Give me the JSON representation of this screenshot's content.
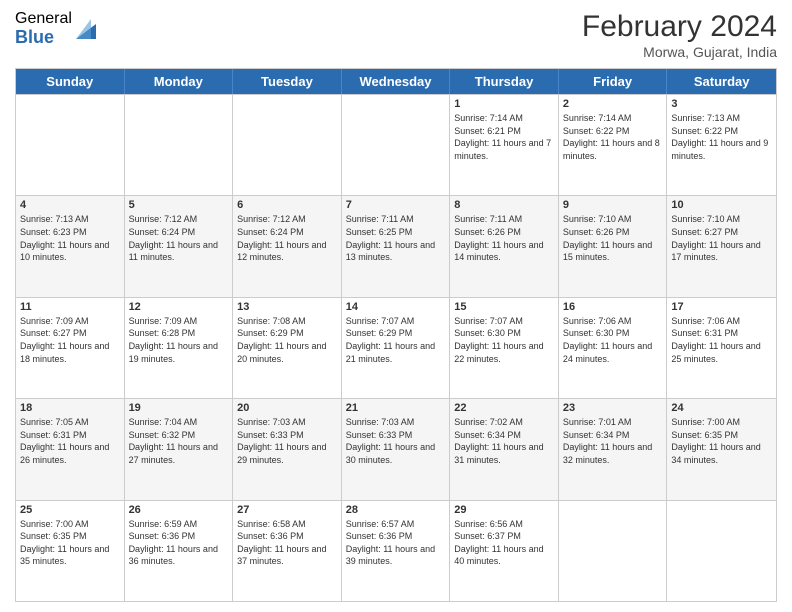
{
  "header": {
    "logo_general": "General",
    "logo_blue": "Blue",
    "month_year": "February 2024",
    "location": "Morwa, Gujarat, India"
  },
  "weekdays": [
    "Sunday",
    "Monday",
    "Tuesday",
    "Wednesday",
    "Thursday",
    "Friday",
    "Saturday"
  ],
  "rows": [
    [
      {
        "day": "",
        "info": ""
      },
      {
        "day": "",
        "info": ""
      },
      {
        "day": "",
        "info": ""
      },
      {
        "day": "",
        "info": ""
      },
      {
        "day": "1",
        "info": "Sunrise: 7:14 AM\nSunset: 6:21 PM\nDaylight: 11 hours and 7 minutes."
      },
      {
        "day": "2",
        "info": "Sunrise: 7:14 AM\nSunset: 6:22 PM\nDaylight: 11 hours and 8 minutes."
      },
      {
        "day": "3",
        "info": "Sunrise: 7:13 AM\nSunset: 6:22 PM\nDaylight: 11 hours and 9 minutes."
      }
    ],
    [
      {
        "day": "4",
        "info": "Sunrise: 7:13 AM\nSunset: 6:23 PM\nDaylight: 11 hours and 10 minutes."
      },
      {
        "day": "5",
        "info": "Sunrise: 7:12 AM\nSunset: 6:24 PM\nDaylight: 11 hours and 11 minutes."
      },
      {
        "day": "6",
        "info": "Sunrise: 7:12 AM\nSunset: 6:24 PM\nDaylight: 11 hours and 12 minutes."
      },
      {
        "day": "7",
        "info": "Sunrise: 7:11 AM\nSunset: 6:25 PM\nDaylight: 11 hours and 13 minutes."
      },
      {
        "day": "8",
        "info": "Sunrise: 7:11 AM\nSunset: 6:26 PM\nDaylight: 11 hours and 14 minutes."
      },
      {
        "day": "9",
        "info": "Sunrise: 7:10 AM\nSunset: 6:26 PM\nDaylight: 11 hours and 15 minutes."
      },
      {
        "day": "10",
        "info": "Sunrise: 7:10 AM\nSunset: 6:27 PM\nDaylight: 11 hours and 17 minutes."
      }
    ],
    [
      {
        "day": "11",
        "info": "Sunrise: 7:09 AM\nSunset: 6:27 PM\nDaylight: 11 hours and 18 minutes."
      },
      {
        "day": "12",
        "info": "Sunrise: 7:09 AM\nSunset: 6:28 PM\nDaylight: 11 hours and 19 minutes."
      },
      {
        "day": "13",
        "info": "Sunrise: 7:08 AM\nSunset: 6:29 PM\nDaylight: 11 hours and 20 minutes."
      },
      {
        "day": "14",
        "info": "Sunrise: 7:07 AM\nSunset: 6:29 PM\nDaylight: 11 hours and 21 minutes."
      },
      {
        "day": "15",
        "info": "Sunrise: 7:07 AM\nSunset: 6:30 PM\nDaylight: 11 hours and 22 minutes."
      },
      {
        "day": "16",
        "info": "Sunrise: 7:06 AM\nSunset: 6:30 PM\nDaylight: 11 hours and 24 minutes."
      },
      {
        "day": "17",
        "info": "Sunrise: 7:06 AM\nSunset: 6:31 PM\nDaylight: 11 hours and 25 minutes."
      }
    ],
    [
      {
        "day": "18",
        "info": "Sunrise: 7:05 AM\nSunset: 6:31 PM\nDaylight: 11 hours and 26 minutes."
      },
      {
        "day": "19",
        "info": "Sunrise: 7:04 AM\nSunset: 6:32 PM\nDaylight: 11 hours and 27 minutes."
      },
      {
        "day": "20",
        "info": "Sunrise: 7:03 AM\nSunset: 6:33 PM\nDaylight: 11 hours and 29 minutes."
      },
      {
        "day": "21",
        "info": "Sunrise: 7:03 AM\nSunset: 6:33 PM\nDaylight: 11 hours and 30 minutes."
      },
      {
        "day": "22",
        "info": "Sunrise: 7:02 AM\nSunset: 6:34 PM\nDaylight: 11 hours and 31 minutes."
      },
      {
        "day": "23",
        "info": "Sunrise: 7:01 AM\nSunset: 6:34 PM\nDaylight: 11 hours and 32 minutes."
      },
      {
        "day": "24",
        "info": "Sunrise: 7:00 AM\nSunset: 6:35 PM\nDaylight: 11 hours and 34 minutes."
      }
    ],
    [
      {
        "day": "25",
        "info": "Sunrise: 7:00 AM\nSunset: 6:35 PM\nDaylight: 11 hours and 35 minutes."
      },
      {
        "day": "26",
        "info": "Sunrise: 6:59 AM\nSunset: 6:36 PM\nDaylight: 11 hours and 36 minutes."
      },
      {
        "day": "27",
        "info": "Sunrise: 6:58 AM\nSunset: 6:36 PM\nDaylight: 11 hours and 37 minutes."
      },
      {
        "day": "28",
        "info": "Sunrise: 6:57 AM\nSunset: 6:36 PM\nDaylight: 11 hours and 39 minutes."
      },
      {
        "day": "29",
        "info": "Sunrise: 6:56 AM\nSunset: 6:37 PM\nDaylight: 11 hours and 40 minutes."
      },
      {
        "day": "",
        "info": ""
      },
      {
        "day": "",
        "info": ""
      }
    ]
  ]
}
